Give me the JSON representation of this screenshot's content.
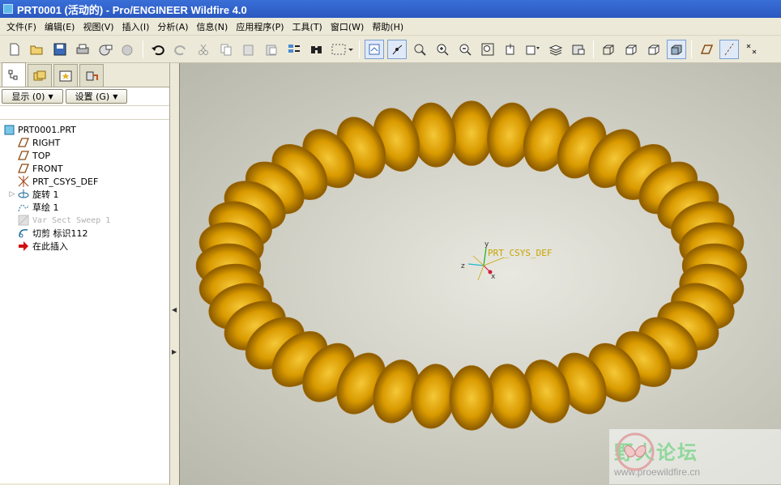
{
  "window": {
    "title": "PRT0001 (活动的) - Pro/ENGINEER Wildfire 4.0"
  },
  "menubar": [
    {
      "label": "文件(F)"
    },
    {
      "label": "编辑(E)"
    },
    {
      "label": "视图(V)"
    },
    {
      "label": "插入(I)"
    },
    {
      "label": "分析(A)"
    },
    {
      "label": "信息(N)"
    },
    {
      "label": "应用程序(P)"
    },
    {
      "label": "工具(T)"
    },
    {
      "label": "窗口(W)"
    },
    {
      "label": "帮助(H)"
    }
  ],
  "toolbar": {
    "icons": [
      "new-icon",
      "open-icon",
      "save-icon",
      "print-icon",
      "email-icon",
      "email-attach-icon",
      "undo-icon",
      "redo-icon",
      "cut-icon",
      "copy-icon",
      "paste-icon",
      "paste-special-icon",
      "regenerate-icon",
      "find-icon",
      "select-box-icon",
      "repaint-icon",
      "spin-center-icon",
      "orient-mode-icon",
      "zoom-in-icon",
      "zoom-out-icon",
      "refit-icon",
      "reorient-icon",
      "saved-views-icon",
      "layers-icon",
      "view-manager-icon",
      "wireframe-icon",
      "hidden-line-icon",
      "no-hidden-icon",
      "shading-icon",
      "datum-planes-icon",
      "datum-axes-icon",
      "datum-points-icon"
    ]
  },
  "left_panel": {
    "tabs": [
      "model-tree-tab",
      "folder-browser-tab",
      "favorites-tab",
      "connections-tab"
    ],
    "show_button": "显示 (0)",
    "settings_button": "设置 (G)",
    "tree": {
      "root": "PRT0001.PRT",
      "items": [
        {
          "label": "RIGHT",
          "icon": "datum-plane-icon",
          "expandable": false,
          "suppressed": false
        },
        {
          "label": "TOP",
          "icon": "datum-plane-icon",
          "expandable": false,
          "suppressed": false
        },
        {
          "label": "FRONT",
          "icon": "datum-plane-icon",
          "expandable": false,
          "suppressed": false
        },
        {
          "label": "PRT_CSYS_DEF",
          "icon": "csys-icon",
          "expandable": false,
          "suppressed": false
        },
        {
          "label": "旋转 1",
          "icon": "revolve-icon",
          "expandable": true,
          "suppressed": false
        },
        {
          "label": "草绘 1",
          "icon": "sketch-icon",
          "expandable": false,
          "suppressed": false
        },
        {
          "label": "Var Sect Sweep 1",
          "icon": "sweep-icon",
          "expandable": false,
          "suppressed": true
        },
        {
          "label": "切剪 标识112",
          "icon": "cut-icon",
          "expandable": false,
          "suppressed": false
        },
        {
          "label": "在此插入",
          "icon": "insert-here-icon",
          "expandable": false,
          "suppressed": false
        }
      ]
    }
  },
  "viewport": {
    "csys_label": "PRT_CSYS_DEF",
    "axis_x": "x",
    "axis_y": "y",
    "axis_z": "z",
    "model_color": "#d99a00"
  },
  "watermark": {
    "title": "野火论坛",
    "url": "www.proewildfire.cn"
  }
}
